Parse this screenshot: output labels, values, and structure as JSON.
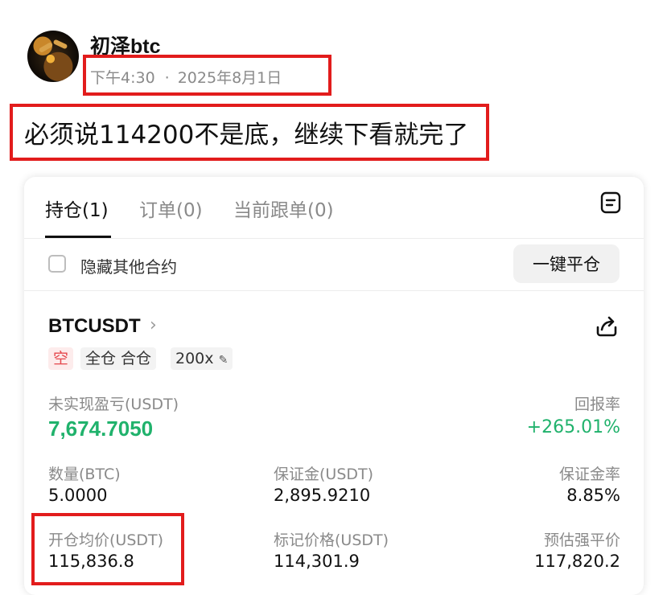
{
  "post": {
    "author": "初泽btc",
    "time": "下午4:30",
    "date": "2025年8月1日",
    "text": "必须说114200不是底，继续下看就完了"
  },
  "tabs": [
    {
      "label": "持仓(1)",
      "active": true
    },
    {
      "label": "订单(0)",
      "active": false
    },
    {
      "label": "当前跟单(0)",
      "active": false
    }
  ],
  "filter": {
    "hide_other_label": "隐藏其他合约",
    "close_all_label": "一键平仓"
  },
  "position": {
    "symbol": "BTCUSDT",
    "side": "空",
    "margin_mode": "全仓 合仓",
    "leverage": "200x",
    "unrealized_pnl_label": "未实现盈亏(USDT)",
    "unrealized_pnl": "7,674.7050",
    "roe_label": "回报率",
    "roe": "+265.01%",
    "quantity_label": "数量(BTC)",
    "quantity": "5.0000",
    "margin_label": "保证金(USDT)",
    "margin": "2,895.9210",
    "margin_ratio_label": "保证金率",
    "margin_ratio": "8.85%",
    "entry_price_label": "开仓均价(USDT)",
    "entry_price": "115,836.8",
    "mark_price_label": "标记价格(USDT)",
    "mark_price": "114,301.9",
    "liq_price_label": "预估强平价",
    "liq_price": "117,820.2"
  },
  "colors": {
    "profit": "#20b26c",
    "short": "#e5484d",
    "highlight": "#e21c1c"
  }
}
